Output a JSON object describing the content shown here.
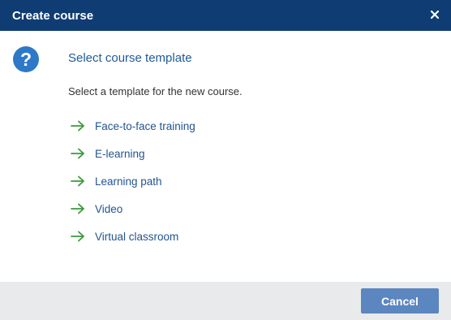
{
  "dialog": {
    "title": "Create course",
    "close_icon": "close-icon",
    "header_icon": "question-circle-icon",
    "header_icon_glyph": "?",
    "heading": "Select course template",
    "intro": "Select a template for the new course.",
    "options": [
      {
        "label": "Face-to-face training",
        "icon": "arrow-right-icon"
      },
      {
        "label": "E-learning",
        "icon": "arrow-right-icon"
      },
      {
        "label": "Learning path",
        "icon": "arrow-right-icon"
      },
      {
        "label": "Video",
        "icon": "arrow-right-icon"
      },
      {
        "label": "Virtual classroom",
        "icon": "arrow-right-icon"
      }
    ],
    "cancel_label": "Cancel"
  },
  "colors": {
    "title_bar": "#0f3d73",
    "accent": "#2d79c8",
    "link": "#23548f",
    "arrow": "#3c9a3c",
    "footer": "#e9eaec",
    "button": "#5b86c0"
  }
}
